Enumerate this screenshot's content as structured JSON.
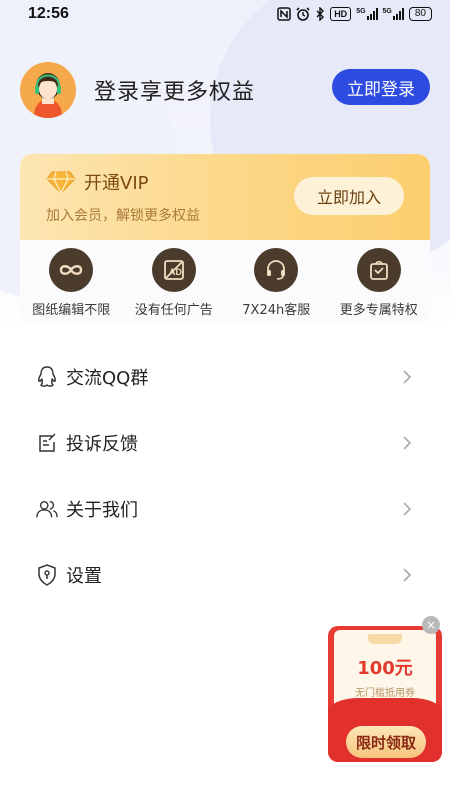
{
  "status_bar": {
    "time": "12:56",
    "hd_label": "HD",
    "net_label_1": "5G",
    "net_label_2": "5G",
    "battery": "80",
    "icons": [
      "nfc-icon",
      "alarm-icon",
      "bluetooth-icon",
      "hd-icon",
      "signal-icon",
      "signal-icon",
      "battery-icon"
    ]
  },
  "user": {
    "login_prompt": "登录享更多权益",
    "login_button": "立即登录"
  },
  "vip": {
    "title": "开通VIP",
    "subtitle": "加入会员，解锁更多权益",
    "join_button": "立即加入",
    "accent": "#fcd88a",
    "perks": [
      {
        "label": "图纸编辑不限",
        "icon": "infinity-icon"
      },
      {
        "label": "没有任何广告",
        "icon": "no-ad-icon"
      },
      {
        "label": "7X24h客服",
        "icon": "headset-icon"
      },
      {
        "label": "更多专属特权",
        "icon": "gift-bag-icon"
      }
    ]
  },
  "menu": [
    {
      "label": "交流QQ群",
      "icon": "qq-icon"
    },
    {
      "label": "投诉反馈",
      "icon": "feedback-icon"
    },
    {
      "label": "关于我们",
      "icon": "users-icon"
    },
    {
      "label": "设置",
      "icon": "shield-icon"
    }
  ],
  "coupon": {
    "amount": "100元",
    "description": "无门槛抵用券",
    "button": "限时领取",
    "close": "×"
  },
  "colors": {
    "primary": "#2d4be0",
    "coupon_red": "#e63a33"
  }
}
